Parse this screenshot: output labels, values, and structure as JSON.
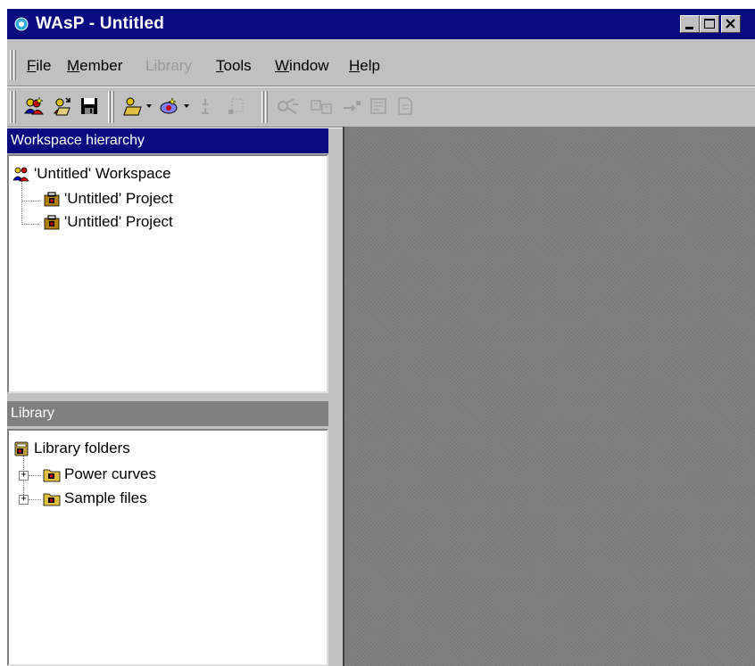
{
  "window": {
    "title": "WAsP - Untitled",
    "icons": {
      "app": "wasp-app-icon",
      "minimize": "minimize-icon",
      "maximize": "maximize-icon",
      "close": "close-icon"
    }
  },
  "menu": {
    "items": [
      {
        "label": "File",
        "mnemonic": "F",
        "rest": "ile",
        "enabled": true
      },
      {
        "label": "Member",
        "mnemonic": "M",
        "rest": "ember",
        "enabled": true
      },
      {
        "label": "Library",
        "mnemonic": "",
        "rest": "Library",
        "enabled": false
      },
      {
        "label": "Tools",
        "mnemonic": "T",
        "rest": "ools",
        "enabled": true
      },
      {
        "label": "Window",
        "mnemonic": "W",
        "rest": "indow",
        "enabled": true
      },
      {
        "label": "Help",
        "mnemonic": "H",
        "rest": "elp",
        "enabled": true
      }
    ]
  },
  "toolbar": {
    "buttons": [
      {
        "icon": "new-workspace-icon",
        "enabled": true
      },
      {
        "icon": "open-workspace-icon",
        "enabled": true
      },
      {
        "icon": "save-icon",
        "enabled": true
      },
      {
        "icon": "open-folder-dropdown-icon",
        "enabled": true
      },
      {
        "icon": "insert-member-dropdown-icon",
        "enabled": true
      },
      {
        "icon": "disconnect-icon",
        "enabled": false
      },
      {
        "icon": "properties-icon",
        "enabled": false
      },
      {
        "icon": "calculate-icon",
        "enabled": false
      },
      {
        "icon": "sites-icon",
        "enabled": false
      },
      {
        "icon": "move-icon",
        "enabled": false
      },
      {
        "icon": "report-icon",
        "enabled": false
      },
      {
        "icon": "document-icon",
        "enabled": false
      }
    ]
  },
  "workspace": {
    "title": "Workspace hierarchy",
    "root": "'Untitled' Workspace",
    "children": [
      "'Untitled' Project",
      "'Untitled' Project"
    ]
  },
  "library": {
    "title": "Library",
    "root": "Library folders",
    "children": [
      "Power curves",
      "Sample files"
    ]
  },
  "colors": {
    "titlebar": "#0a0a80",
    "active_panel_title": "#0a0a80",
    "inactive_panel_title": "#808080",
    "mdi_background": "#7e7e7e",
    "face": "#c0c0c0"
  }
}
